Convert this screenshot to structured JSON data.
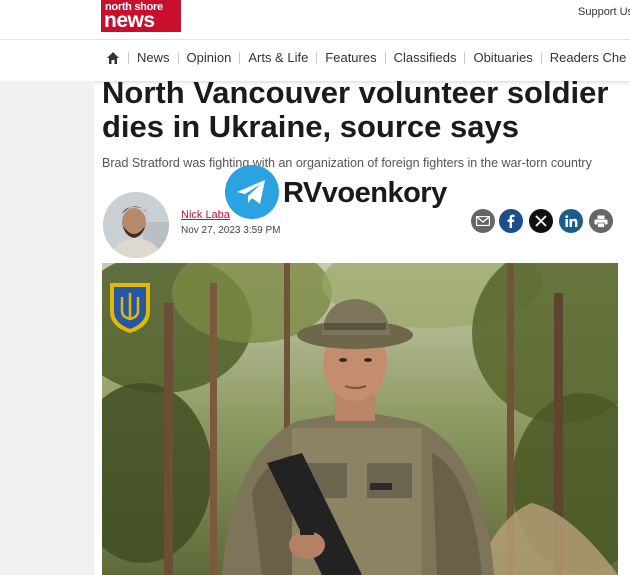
{
  "header": {
    "logo_line1": "north shore",
    "logo_line2": "news",
    "support_label": "Support Us"
  },
  "nav": {
    "items": [
      "News",
      "Opinion",
      "Arts & Life",
      "Features",
      "Classifieds",
      "Obituaries",
      "Readers Che"
    ]
  },
  "article": {
    "headline": "North Vancouver volunteer soldier dies in Ukraine, source says",
    "subhead": "Brad Stratford was fighting with an organization of foreign fighters in the war-torn country",
    "author": "Nick Laba",
    "date": "Nov 27, 2023 3:59 PM"
  },
  "watermark": {
    "text": "RVvoenkory"
  },
  "share_icons": [
    "envelope-icon",
    "facebook-icon",
    "x-icon",
    "linkedin-icon",
    "print-icon"
  ],
  "colors": {
    "brand_red": "#c8102e",
    "facebook": "#1d4e89",
    "linkedin": "#1a5e8e",
    "telegram": "#2aa3e0"
  }
}
